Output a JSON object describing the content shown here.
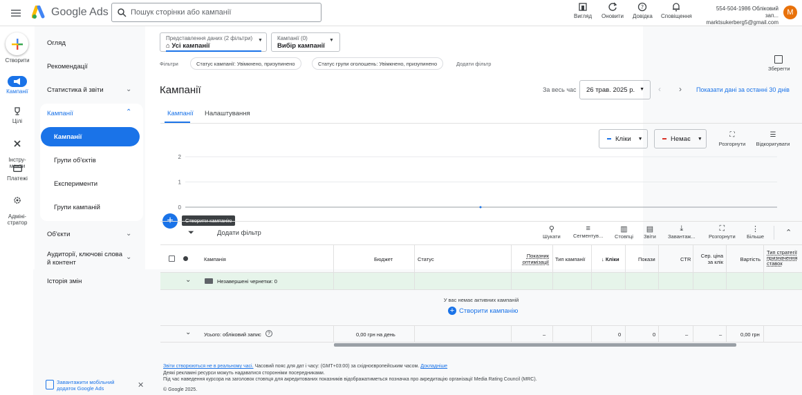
{
  "header": {
    "brand": "Google Ads",
    "search_placeholder": "Пошук сторінки або кампанії",
    "buttons": [
      {
        "label": "Вигляд",
        "icon": "view-icon"
      },
      {
        "label": "Оновити",
        "icon": "refresh-icon"
      },
      {
        "label": "Довідка",
        "icon": "help-icon"
      },
      {
        "label": "Сповіщення",
        "icon": "bell-icon"
      }
    ],
    "account_line1": "554-504-1986 Обліковий зап...",
    "account_line2": "marktsukerberg5@gmail.com",
    "avatar_letter": "M"
  },
  "rail": {
    "create": "Створити",
    "items": [
      {
        "label": "Кампанії",
        "icon": "megaphone-icon"
      },
      {
        "label": "Цілі",
        "icon": "trophy-icon"
      },
      {
        "label": "Інстру-\nменти",
        "icon": "tools-icon"
      },
      {
        "label": "Платежі",
        "icon": "card-icon"
      },
      {
        "label": "Адміні-\nстратор",
        "icon": "gear-icon"
      }
    ]
  },
  "nav": {
    "overview": "Огляд",
    "recommendations": "Рекомендації",
    "stats": "Статистика й звіти",
    "campaigns_group": "Кампанії",
    "campaigns": "Кампанії",
    "asset_groups": "Групи об'єктів",
    "experiments": "Експерименти",
    "campaign_groups": "Групи кампаній",
    "assets": "Об'єкти",
    "audiences_line1": "Аудиторії, ключові слова",
    "audiences_line2": "й контент",
    "history": "Історія змін",
    "mobile_line1": "Завантажити мобільний",
    "mobile_line2": "додаток Google Ads"
  },
  "view": {
    "view_label": "Представлення даних (2 фільтри)",
    "view_value": "Усі кампанії",
    "campaign_label": "Кампанії (0)",
    "campaign_value": "Вибір кампанії",
    "filters_label": "Фільтри",
    "filter1": "Статус кампанії: Увімкнено, призупинено",
    "filter2": "Статус групи оголошень: Увімкнено, призупинено",
    "add_filter": "Додати фільтр",
    "save": "Зберегти"
  },
  "page": {
    "title": "Кампанії",
    "range_label": "За весь час",
    "date": "26 трав. 2025 р.",
    "show_30": "Показати дані за останні 30 днів",
    "tabs": [
      "Кампанії",
      "Налаштування"
    ]
  },
  "chart": {
    "metric1": "Кліки",
    "metric2": "Немає",
    "expand": "Розгорнути",
    "adjust": "Відкоригувати",
    "metric1_color": "#1a73e8",
    "metric2_color": "#d93025"
  },
  "chart_data": {
    "type": "line",
    "series": [
      {
        "name": "Кліки",
        "x": [
          0
        ],
        "values": [
          0
        ]
      }
    ],
    "yticks": [
      "2",
      "1",
      "0"
    ],
    "ylim": [
      0,
      2
    ],
    "grid": true
  },
  "table": {
    "tooltip": "Створити кампанію",
    "add_filter": "Додати фільтр",
    "tools": [
      {
        "label": "Шукати",
        "icon": "search-icon"
      },
      {
        "label": "Сегментув...",
        "icon": "segment-icon"
      },
      {
        "label": "Стовпці",
        "icon": "columns-icon"
      },
      {
        "label": "Звіти",
        "icon": "reports-icon"
      },
      {
        "label": "Завантаж...",
        "icon": "download-icon"
      },
      {
        "label": "Розгорнути",
        "icon": "expand-icon"
      },
      {
        "label": "Більше",
        "icon": "more-icon"
      }
    ],
    "headers": {
      "campaign": "Кампанія",
      "budget": "Бюджет",
      "status": "Статус",
      "opt1": "Показник",
      "opt2": "оптимізації",
      "type": "Тип кампанії",
      "clicks": "Кліки",
      "impr": "Покази",
      "ctr": "CTR",
      "cpc1": "Сер. ціна",
      "cpc2": "за клік",
      "cost": "Вартість",
      "strat1": "Тип стратегії",
      "strat2": "призначення",
      "strat3": "ставок"
    },
    "drafts": "Незавершені чернетки: 0",
    "empty": "У вас немає активних кампаній",
    "create": "Створити кампанію",
    "total": {
      "label": "Усього: обліковий запис",
      "budget": "0,00 грн на день",
      "opt": "–",
      "clicks": "0",
      "impr": "0",
      "ctr": "–",
      "cpc": "–",
      "cost": "0,00 грн"
    }
  },
  "footer": {
    "line1_link": "Звіти створюються не в реальному часі.",
    "line1_text": " Часовий пояс для дат і часу: (GMT+03:00) за східноєвропейським часом. ",
    "line1_more": "Докладніше",
    "line2": "Деякі рекламні ресурси можуть надаватися сторонніми посередниками.",
    "line3": "Під час наведення курсора на заголовок стовпця для акредитованих показників відображатиметься позначка про акредитацію організації Media Rating Council (MRC).",
    "copyright": "© Google 2025."
  }
}
